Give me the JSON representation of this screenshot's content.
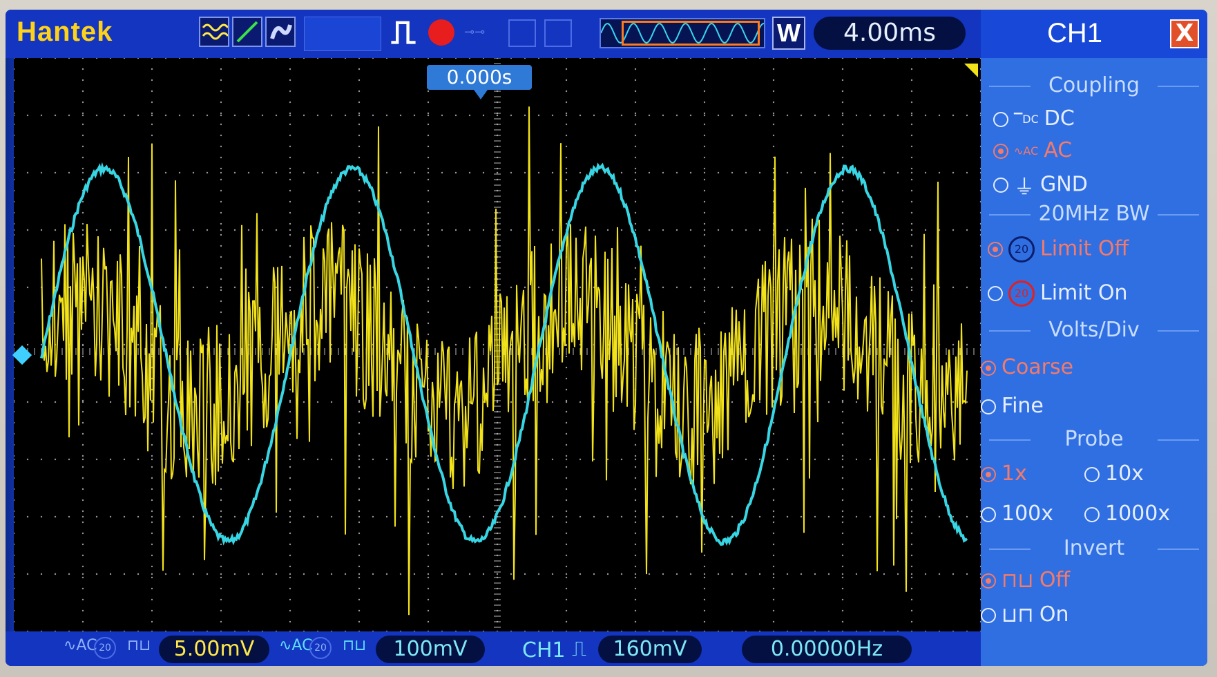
{
  "header": {
    "brand": "Hantek",
    "timebase": "4.00ms",
    "zoom_label": "W",
    "trigger_time_position": "0.000s"
  },
  "panel": {
    "title": "CH1",
    "close_label": "X",
    "coupling": {
      "title": "Coupling",
      "options": [
        {
          "label": "DC",
          "icon": "dc-icon",
          "selected": false
        },
        {
          "label": "AC",
          "icon": "ac-icon",
          "selected": true
        },
        {
          "label": "GND",
          "icon": "ground-icon",
          "selected": false
        }
      ]
    },
    "bandwidth": {
      "title": "20MHz BW",
      "options": [
        {
          "label": "Limit Off",
          "selected": true
        },
        {
          "label": "Limit On",
          "selected": false
        }
      ]
    },
    "volts_div": {
      "title": "Volts/Div",
      "options": [
        {
          "label": "Coarse",
          "selected": true
        },
        {
          "label": "Fine",
          "selected": false
        }
      ]
    },
    "probe": {
      "title": "Probe",
      "options": [
        {
          "label": "1x",
          "selected": true
        },
        {
          "label": "10x",
          "selected": false
        },
        {
          "label": "100x",
          "selected": false
        },
        {
          "label": "1000x",
          "selected": false
        }
      ]
    },
    "invert": {
      "title": "Invert",
      "options": [
        {
          "label": "Off",
          "selected": true
        },
        {
          "label": "On",
          "selected": false
        }
      ]
    }
  },
  "footer": {
    "ch1_scale": "5.00mV",
    "ch2_scale": "100mV",
    "trigger_source": "CH1",
    "trigger_level": "160mV",
    "frequency": "0.00000Hz"
  },
  "colors": {
    "ch1": "#f2e21a",
    "ch2": "#38d6e4",
    "panel_bg": "#2f6fe2",
    "screen_bg": "#1237b8"
  }
}
